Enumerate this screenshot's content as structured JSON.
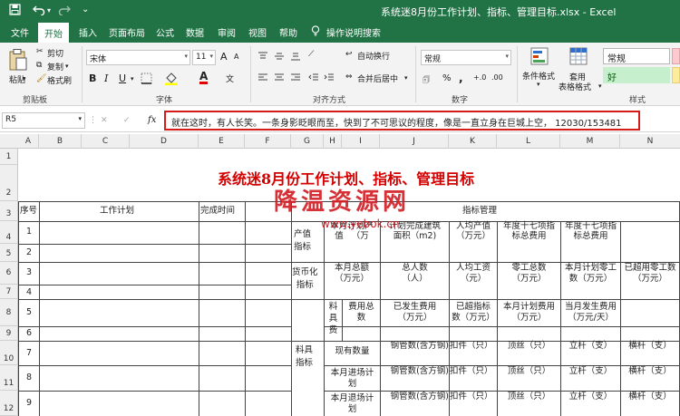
{
  "window": {
    "title": "系统迷8月份工作计划、指标、管理目标.xlsx  -  Excel"
  },
  "quick_access": {
    "save_icon": "save-icon",
    "undo_icon": "undo-icon",
    "redo_icon": "redo-icon"
  },
  "tabs": [
    "文件",
    "开始",
    "插入",
    "页面布局",
    "公式",
    "数据",
    "审阅",
    "视图",
    "帮助",
    "操作说明搜索"
  ],
  "ribbon": {
    "clipboard": {
      "paste": "粘贴",
      "cut": "剪切",
      "copy": "复制",
      "format_painter": "格式刷",
      "label": "剪贴板"
    },
    "font": {
      "name": "宋体",
      "size": "11",
      "bold": "B",
      "italic": "I",
      "underline": "U",
      "font_color": "A",
      "grow": "A",
      "shrink": "A",
      "label": "字体"
    },
    "alignment": {
      "wrap": "自动换行",
      "merge": "合并后居中",
      "label": "对齐方式"
    },
    "number": {
      "format": "常规",
      "percent": "%",
      "comma": ",",
      "label": "数字"
    },
    "styles": {
      "conditional": "条件格式",
      "table_format_1": "套用",
      "table_format_2": "表格格式",
      "normal": "常规",
      "good": "好",
      "label": "样式"
    }
  },
  "formula_bar": {
    "name_box": "R5",
    "fx": "fx",
    "cancel": "✕",
    "enter": "✓",
    "content": "就在这时，有人长笑。一条身影眨眼而至，快到了不可思议的程度，像是一直立身在巨城上空，  12030/153481"
  },
  "columns": [
    "A",
    "B",
    "C",
    "D",
    "E",
    "F",
    "G",
    "H",
    "I",
    "J",
    "K",
    "L",
    "M",
    "N"
  ],
  "rows": [
    "1",
    "2",
    "3",
    "4",
    "5",
    "6",
    "7",
    "8",
    "9",
    "10",
    "11",
    "12"
  ],
  "sheet": {
    "title": "系统迷8月份工作计划、指标、管理目标",
    "headers": {
      "seq": "序号",
      "plan": "工作计划",
      "done_time": "完成时间",
      "mgmt": "指标管理"
    },
    "seq_numbers": [
      "1",
      "2",
      "3",
      "4",
      "5",
      "6",
      "7",
      "8",
      "9"
    ],
    "cat_output": [
      "产值",
      "指标"
    ],
    "cat_money": [
      "货币化",
      "指标"
    ],
    "cat_material": [
      "料具",
      "指标"
    ],
    "mat_fee": [
      "料",
      "具",
      "费"
    ],
    "r4": {
      "monthly_output": [
        "本月计划产",
        "值",
        "（万"
      ],
      "area": [
        "计划完成建筑",
        "面积（m2)"
      ],
      "per_capita_output": [
        "人均产值",
        "（万元）"
      ],
      "annual17_a": [
        "年度十七项指",
        "标总费用"
      ],
      "annual17_b": [
        "年度十七项指",
        "标总费用"
      ]
    },
    "r6": {
      "monthly_total": [
        "本月总额",
        "（万元）"
      ],
      "headcount": [
        "总人数",
        "（人）"
      ],
      "avg_wage": [
        "人均工资",
        "（元）"
      ],
      "piece_total": [
        "零工总数",
        "（万元）"
      ],
      "planned_piece": [
        "本月计划零工",
        "数（万元）"
      ],
      "used_piece": [
        "已超用零工数",
        "（万元）"
      ]
    },
    "r8": {
      "fee_total": [
        "费用总",
        "数"
      ],
      "incurred": [
        "已发生费用",
        "（万元）"
      ],
      "exceeded": [
        "已超指标",
        "数（万元）"
      ],
      "planned_fee": [
        "本月计划费用",
        "（万元）"
      ],
      "monthly_incurred": [
        "当月发生费用",
        "（万元/天）"
      ]
    },
    "r10": {
      "label": "现有数量",
      "pipe": "钢管数(含方钢)",
      "clamp": "扣件（只）",
      "jack": "顶丝（只）",
      "post": "立杆（支）",
      "bar": "横杆（支）"
    },
    "r11": {
      "label": [
        "本月进场计",
        "划"
      ],
      "pipe": "钢管数(含方钢)",
      "clamp": "扣件（只）",
      "jack": "顶丝（只）",
      "post": "立杆（支）",
      "bar": "横杆（支）"
    },
    "r12": {
      "label": [
        "本月退场计",
        "划"
      ],
      "pipe": "钢管数(含方钢)",
      "clamp": "扣件（只）",
      "jack": "顶丝（只）",
      "post": "立杆（支）",
      "bar": "横杆（支）"
    }
  },
  "watermark": {
    "main": "降温资源网",
    "sub": "www.yebok.cn"
  },
  "colors": {
    "excel_green": "#217346",
    "title_red": "#d40000",
    "highlight_border": "#d61b1b",
    "good_style_bg": "#c6efce"
  }
}
